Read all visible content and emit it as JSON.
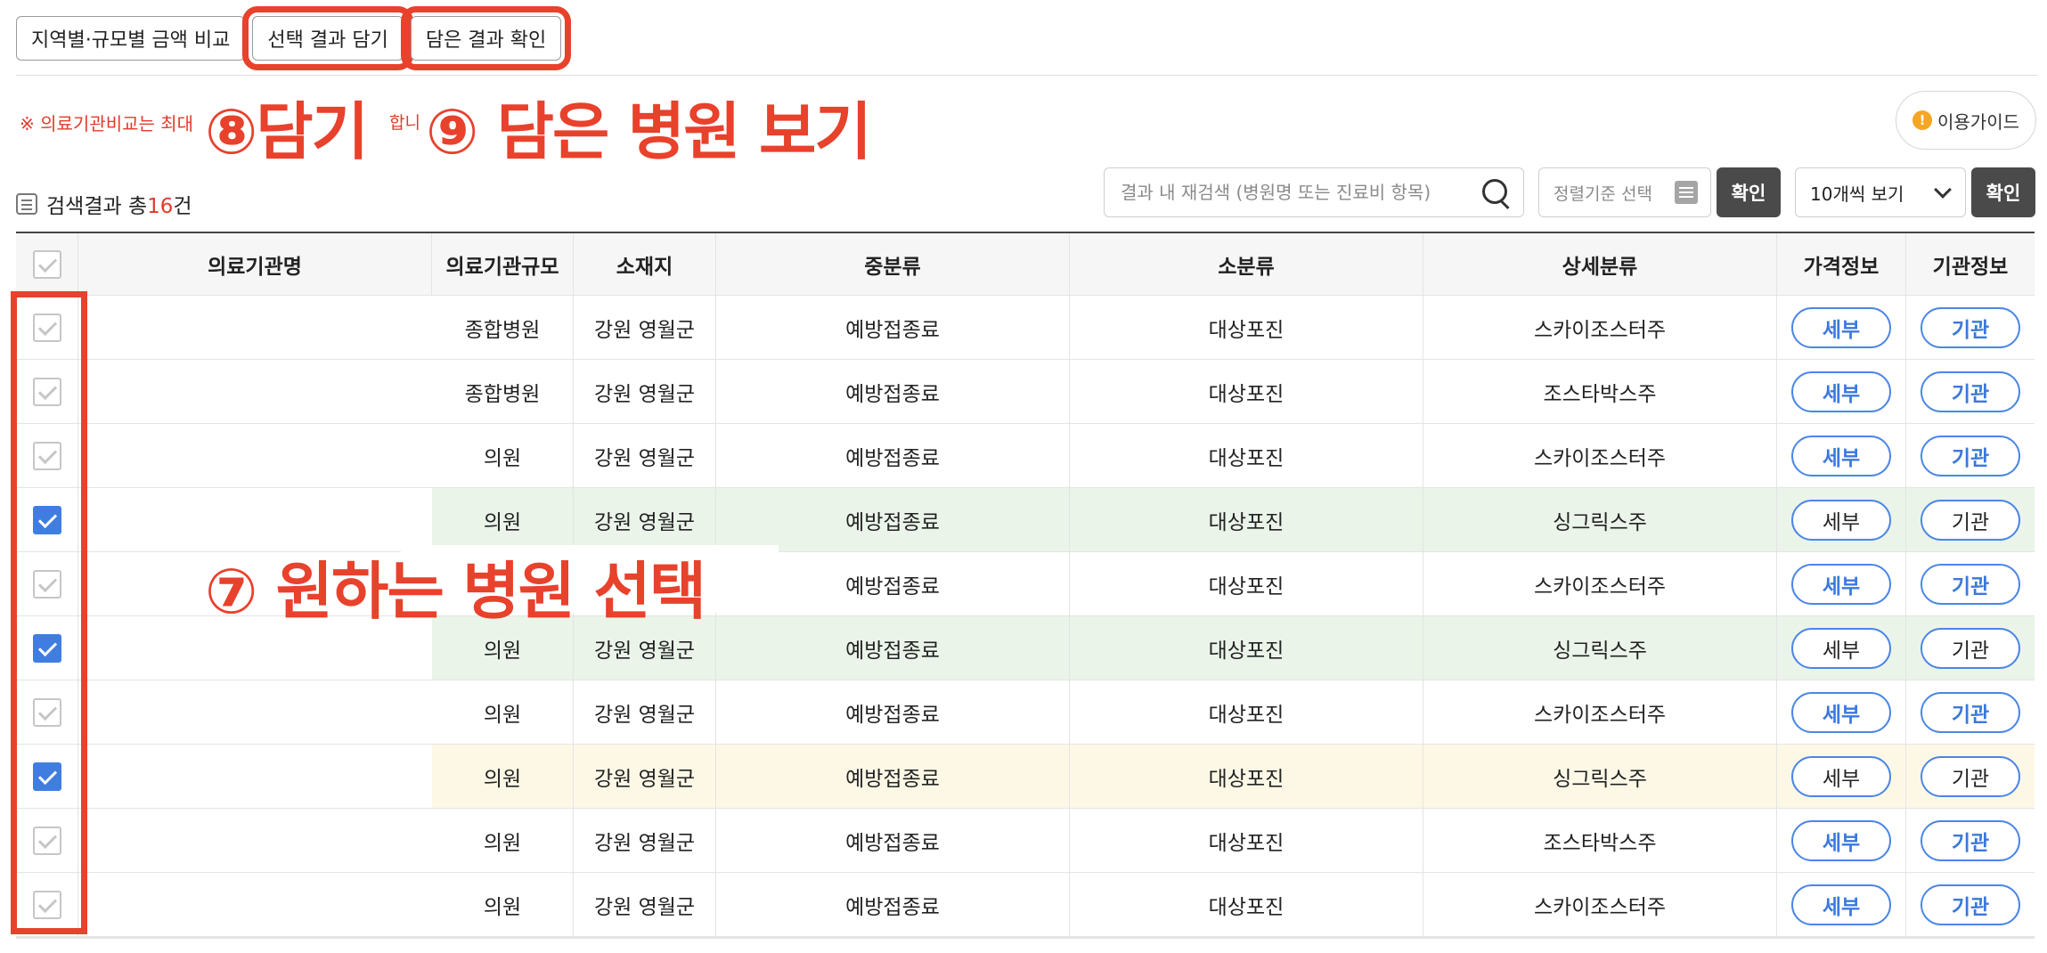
{
  "tabs": [
    {
      "label": "지역별·규모별 금액 비교"
    },
    {
      "label": "선택 결과 담기"
    },
    {
      "label": "담은 결과 확인"
    }
  ],
  "notice": {
    "text": "※ 의료기관비교는 최대",
    "tail": "합니"
  },
  "annotations": {
    "step8": "⑧담기",
    "step9": "⑨ 담은 병원 보기",
    "step7": "⑦ 원하는 병원 선택"
  },
  "guide": {
    "label": "이용가이드",
    "icon": "!"
  },
  "results": {
    "prefix": "검색결과 총",
    "count": "16",
    "suffix": "건"
  },
  "search": {
    "placeholder": "결과 내 재검색 (병원명 또는 진료비 항목)"
  },
  "sort": {
    "label": "정렬기준 선택"
  },
  "confirm_label": "확인",
  "perpage": {
    "label": "10개씩 보기"
  },
  "table": {
    "headers": [
      "의료기관명",
      "의료기관규모",
      "소재지",
      "중분류",
      "소분류",
      "상세분류",
      "가격정보",
      "기관정보"
    ],
    "detail_label": "세부",
    "org_label": "기관",
    "rows": [
      {
        "scale": "종합병원",
        "loc": "강원 영월군",
        "mid": "예방접종료",
        "small": "대상포진",
        "detail": "스카이조스터주",
        "checked": false,
        "style": ""
      },
      {
        "scale": "종합병원",
        "loc": "강원 영월군",
        "mid": "예방접종료",
        "small": "대상포진",
        "detail": "조스타박스주",
        "checked": false,
        "style": ""
      },
      {
        "scale": "의원",
        "loc": "강원 영월군",
        "mid": "예방접종료",
        "small": "대상포진",
        "detail": "스카이조스터주",
        "checked": false,
        "style": ""
      },
      {
        "scale": "의원",
        "loc": "강원 영월군",
        "mid": "예방접종료",
        "small": "대상포진",
        "detail": "싱그릭스주",
        "checked": true,
        "style": "green"
      },
      {
        "scale": "",
        "loc": "",
        "mid": "예방접종료",
        "small": "대상포진",
        "detail": "스카이조스터주",
        "checked": false,
        "style": ""
      },
      {
        "scale": "의원",
        "loc": "강원 영월군",
        "mid": "예방접종료",
        "small": "대상포진",
        "detail": "싱그릭스주",
        "checked": true,
        "style": "green"
      },
      {
        "scale": "의원",
        "loc": "강원 영월군",
        "mid": "예방접종료",
        "small": "대상포진",
        "detail": "스카이조스터주",
        "checked": false,
        "style": ""
      },
      {
        "scale": "의원",
        "loc": "강원 영월군",
        "mid": "예방접종료",
        "small": "대상포진",
        "detail": "싱그릭스주",
        "checked": true,
        "style": "yellow"
      },
      {
        "scale": "의원",
        "loc": "강원 영월군",
        "mid": "예방접종료",
        "small": "대상포진",
        "detail": "조스타박스주",
        "checked": false,
        "style": ""
      },
      {
        "scale": "의원",
        "loc": "강원 영월군",
        "mid": "예방접종료",
        "small": "대상포진",
        "detail": "스카이조스터주",
        "checked": false,
        "style": ""
      }
    ]
  },
  "colors": {
    "annotation": "#e8412c",
    "accent_blue": "#3f7ee0",
    "count_red": "#e33a2a"
  }
}
